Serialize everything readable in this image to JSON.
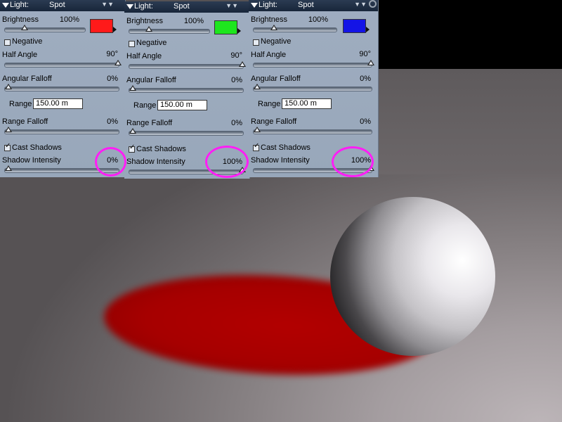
{
  "panels": [
    {
      "header_label": "Light:",
      "header_value": "Spot",
      "brightness_label": "Brightness",
      "brightness_value": "100%",
      "color": "#ff1a1a",
      "negative_label": "Negative",
      "negative_checked": false,
      "half_angle_label": "Half Angle",
      "half_angle_value": "90°",
      "angular_falloff_label": "Angular Falloff",
      "angular_falloff_value": "0%",
      "range_label": "Range",
      "range_value": "150.00 m",
      "range_falloff_label": "Range Falloff",
      "range_falloff_value": "0%",
      "cast_shadows_label": "Cast Shadows",
      "cast_shadows_checked": true,
      "shadow_intensity_label": "Shadow Intensity",
      "shadow_intensity_value": "0%"
    },
    {
      "header_label": "Light:",
      "header_value": "Spot",
      "brightness_label": "Brightness",
      "brightness_value": "100%",
      "color": "#1ee61e",
      "negative_label": "Negative",
      "negative_checked": false,
      "half_angle_label": "Half Angle",
      "half_angle_value": "90°",
      "angular_falloff_label": "Angular Falloff",
      "angular_falloff_value": "0%",
      "range_label": "Range",
      "range_value": "150.00 m",
      "range_falloff_label": "Range Falloff",
      "range_falloff_value": "0%",
      "cast_shadows_label": "Cast Shadows",
      "cast_shadows_checked": true,
      "shadow_intensity_label": "Shadow Intensity",
      "shadow_intensity_value": "100%"
    },
    {
      "header_label": "Light:",
      "header_value": "Spot",
      "brightness_label": "Brightness",
      "brightness_value": "100%",
      "color": "#1414e6",
      "negative_label": "Negative",
      "negative_checked": false,
      "half_angle_label": "Half Angle",
      "half_angle_value": "90°",
      "angular_falloff_label": "Angular Falloff",
      "angular_falloff_value": "0%",
      "range_label": "Range",
      "range_value": "150.00 m",
      "range_falloff_label": "Range Falloff",
      "range_falloff_value": "0%",
      "cast_shadows_label": "Cast Shadows",
      "cast_shadows_checked": true,
      "shadow_intensity_label": "Shadow Intensity",
      "shadow_intensity_value": "100%"
    }
  ],
  "sliders": {
    "brightness": 0.2,
    "half_angle": 1.0,
    "angular_falloff": 0.0,
    "range_falloff": 0.0,
    "shadow_intensity": [
      0.0,
      1.0,
      1.0
    ]
  },
  "scene": {
    "shadow_color": "#a60000",
    "highlight_color": "#ff1ef5"
  },
  "icons": [
    "collapse-triangle-icon",
    "chevron-down-icon",
    "gear-icon",
    "checkbox-icon",
    "slider-thumb-icon",
    "swatch-arrow-icon"
  ]
}
